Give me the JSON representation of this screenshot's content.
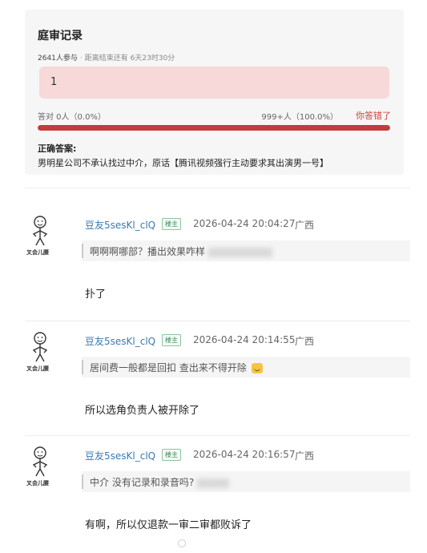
{
  "quiz": {
    "title": "庭审记录",
    "participants": "2641人参与",
    "time_left_label": "距离结束还有",
    "time_left_value": "6天23时30分",
    "selected_answer": "1",
    "correct_stat": "答对 0人（0.0%）",
    "wrong_stat": "999+人（100.0%）",
    "result_badge": "你答错了",
    "wrong_fraction": 1.0,
    "correct_answer_label": "正确答案:",
    "correct_answer_text": "男明星公司不承认找过中介，原话【腾讯视频强行主动要求其出演男一号】"
  },
  "comments": [
    {
      "avatar_caption": "叉会儿腰",
      "username": "豆友5sesKl_clQ",
      "badge": "楼主",
      "timestamp": "2026-04-24 20:04:27",
      "location": "广西",
      "quote": "啊啊啊哪部？播出效果咋样",
      "reply": "扑了"
    },
    {
      "avatar_caption": "叉会儿腰",
      "username": "豆友5sesKl_clQ",
      "badge": "楼主",
      "timestamp": "2026-04-24 20:14:55",
      "location": "广西",
      "quote": "居间费一般都是回扣 查出来不得开除",
      "reply": "所以选角负责人被开除了"
    },
    {
      "avatar_caption": "叉会儿腰",
      "username": "豆友5sesKl_clQ",
      "badge": "楼主",
      "timestamp": "2026-04-24 20:16:57",
      "location": "广西",
      "quote": "中介 没有记录和录音吗?",
      "reply": "有啊，所以仅退款一审二审都败诉了"
    }
  ],
  "colors": {
    "progress": "#c33b3b",
    "answer_box": "#f7d9d9",
    "username": "#3b7ab0",
    "wrong_badge": "#d2413c"
  }
}
